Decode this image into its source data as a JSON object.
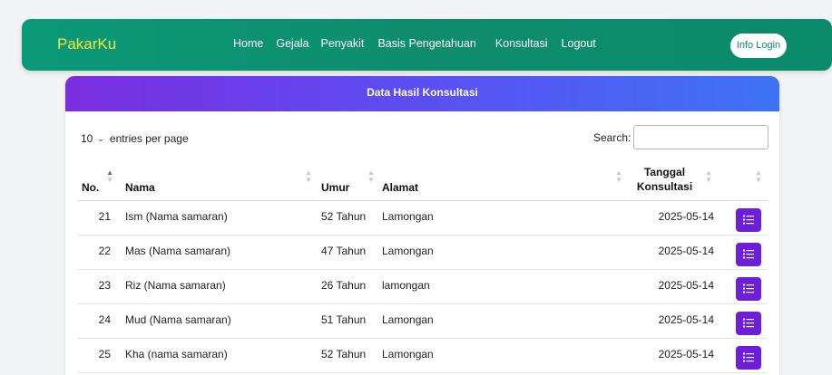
{
  "navbar": {
    "brand": "PakarKu",
    "links": [
      "Home",
      "Gejala",
      "Penyakit",
      "Basis Pengetahuan",
      "Konsultasi",
      "Logout"
    ],
    "info_login": "Info Login"
  },
  "card": {
    "title": "Data Hasil Konsultasi"
  },
  "controls": {
    "entries_value": "10",
    "entries_label": "entries per page",
    "search_label": "Search:",
    "search_value": ""
  },
  "table": {
    "headers": {
      "no": "No.",
      "nama": "Nama",
      "umur": "Umur",
      "alamat": "Alamat",
      "tanggal_line1": "Tanggal",
      "tanggal_line2": "Konsultasi"
    },
    "rows": [
      {
        "no": "21",
        "nama": "Ism (Nama samaran)",
        "umur": "52 Tahun",
        "alamat": "Lamongan",
        "tanggal": "2025-05-14"
      },
      {
        "no": "22",
        "nama": "Mas (Nama samaran)",
        "umur": "47 Tahun",
        "alamat": "Lamongan",
        "tanggal": "2025-05-14"
      },
      {
        "no": "23",
        "nama": "Riz (Nama samaran)",
        "umur": "26 Tahun",
        "alamat": "lamongan",
        "tanggal": "2025-05-14"
      },
      {
        "no": "24",
        "nama": "Mud (Nama samaran)",
        "umur": "51 Tahun",
        "alamat": "Lamongan",
        "tanggal": "2025-05-14"
      },
      {
        "no": "25",
        "nama": "Kha (nama samaran)",
        "umur": "52 Tahun",
        "alamat": "Lamongan",
        "tanggal": "2025-05-14"
      }
    ]
  },
  "colors": {
    "navbar": "#0e8c6c",
    "brand": "#f7e93a",
    "header_gradient_start": "#7a2ee0",
    "header_gradient_end": "#3d73f5",
    "action_button": "#6d1fd8"
  },
  "icons": {
    "action": "list-icon",
    "sort": "sort-icon"
  }
}
